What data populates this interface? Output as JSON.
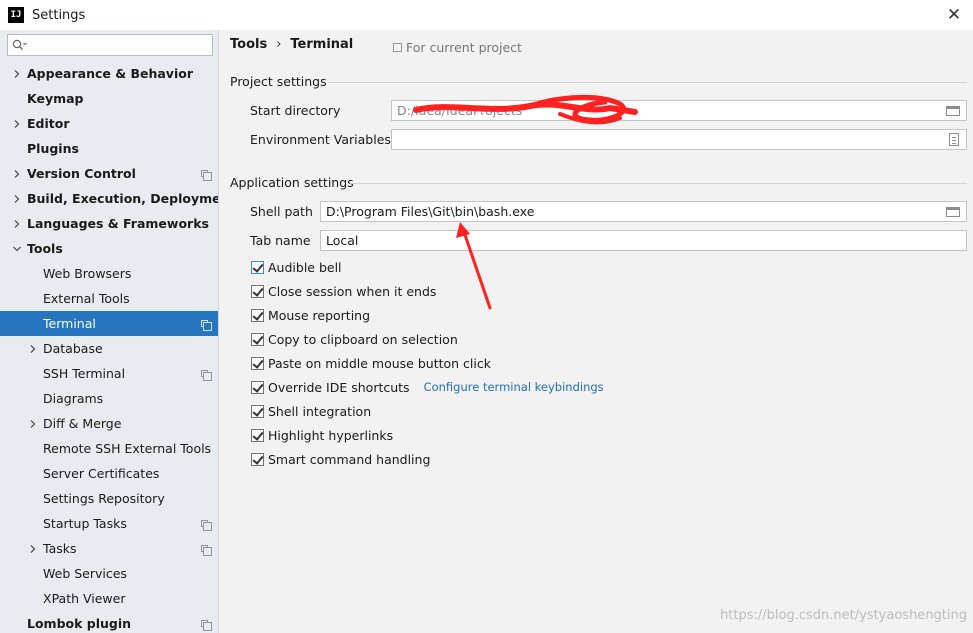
{
  "window": {
    "app_icon_text": "IJ",
    "title": "Settings",
    "close_symbol": "✕"
  },
  "sidebar": {
    "search_placeholder": "",
    "items": [
      {
        "label": "Appearance & Behavior",
        "level": 0,
        "arrow": "right",
        "copy_icon": false
      },
      {
        "label": "Keymap",
        "level": 0,
        "arrow": "none",
        "copy_icon": false
      },
      {
        "label": "Editor",
        "level": 0,
        "arrow": "right",
        "copy_icon": false
      },
      {
        "label": "Plugins",
        "level": 0,
        "arrow": "none",
        "copy_icon": false
      },
      {
        "label": "Version Control",
        "level": 0,
        "arrow": "right",
        "copy_icon": true
      },
      {
        "label": "Build, Execution, Deployment",
        "level": 0,
        "arrow": "right",
        "copy_icon": false
      },
      {
        "label": "Languages & Frameworks",
        "level": 0,
        "arrow": "right",
        "copy_icon": false
      },
      {
        "label": "Tools",
        "level": 0,
        "arrow": "down",
        "copy_icon": false
      },
      {
        "label": "Web Browsers",
        "level": 1,
        "arrow": "none",
        "copy_icon": false
      },
      {
        "label": "External Tools",
        "level": 1,
        "arrow": "none",
        "copy_icon": false
      },
      {
        "label": "Terminal",
        "level": 1,
        "arrow": "none",
        "copy_icon": true,
        "selected": true
      },
      {
        "label": "Database",
        "level": 1,
        "arrow": "right",
        "copy_icon": false
      },
      {
        "label": "SSH Terminal",
        "level": 1,
        "arrow": "none",
        "copy_icon": true
      },
      {
        "label": "Diagrams",
        "level": 1,
        "arrow": "none",
        "copy_icon": false
      },
      {
        "label": "Diff & Merge",
        "level": 1,
        "arrow": "right",
        "copy_icon": false
      },
      {
        "label": "Remote SSH External Tools",
        "level": 1,
        "arrow": "none",
        "copy_icon": false
      },
      {
        "label": "Server Certificates",
        "level": 1,
        "arrow": "none",
        "copy_icon": false
      },
      {
        "label": "Settings Repository",
        "level": 1,
        "arrow": "none",
        "copy_icon": false
      },
      {
        "label": "Startup Tasks",
        "level": 1,
        "arrow": "none",
        "copy_icon": true
      },
      {
        "label": "Tasks",
        "level": 1,
        "arrow": "right",
        "copy_icon": true
      },
      {
        "label": "Web Services",
        "level": 1,
        "arrow": "none",
        "copy_icon": false
      },
      {
        "label": "XPath Viewer",
        "level": 1,
        "arrow": "none",
        "copy_icon": false
      },
      {
        "label": "Lombok plugin",
        "level": 0,
        "arrow": "none",
        "copy_icon": true
      }
    ]
  },
  "main": {
    "breadcrumb": {
      "parent": "Tools",
      "separator": "›",
      "current": "Terminal"
    },
    "for_current_project": "For current project",
    "project_settings": {
      "title": "Project settings",
      "start_directory_label": "Start directory",
      "start_directory_value": "D:/idea/IdeaProjects",
      "env_vars_label": "Environment Variables",
      "env_vars_value": ""
    },
    "application_settings": {
      "title": "Application settings",
      "shell_path_label": "Shell path",
      "shell_path_value": "D:\\Program Files\\Git\\bin\\bash.exe",
      "tab_name_label": "Tab name",
      "tab_name_value": "Local",
      "checkboxes": [
        {
          "label": "Audible bell",
          "checked": true
        },
        {
          "label": "Close session when it ends",
          "checked": true
        },
        {
          "label": "Mouse reporting",
          "checked": true
        },
        {
          "label": "Copy to clipboard on selection",
          "checked": true
        },
        {
          "label": "Paste on middle mouse button click",
          "checked": true
        },
        {
          "label": "Override IDE shortcuts",
          "checked": true
        },
        {
          "label": "Shell integration",
          "checked": true
        },
        {
          "label": "Highlight hyperlinks",
          "checked": true
        },
        {
          "label": "Smart command handling",
          "checked": true
        }
      ],
      "configure_link": "Configure terminal keybindings"
    }
  },
  "watermark": "https://blog.csdn.net/ystyaoshengting",
  "colors": {
    "selection": "#2675bf",
    "link": "#2470b3",
    "annotation_red": "#ff2020"
  }
}
